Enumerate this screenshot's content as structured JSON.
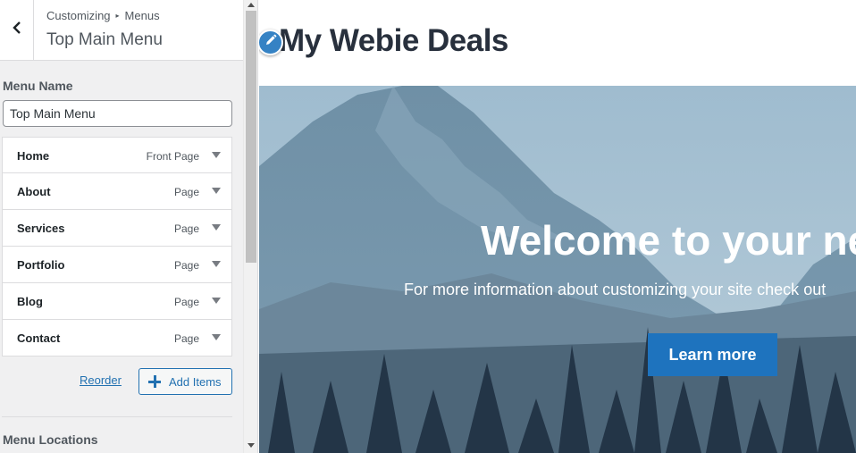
{
  "sidebar": {
    "breadcrumb": {
      "root": "Customizing",
      "separator": "▸",
      "section": "Menus"
    },
    "title": "Top Main Menu",
    "menu_name_label": "Menu Name",
    "menu_name_value": "Top Main Menu",
    "items": [
      {
        "title": "Home",
        "type": "Front Page"
      },
      {
        "title": "About",
        "type": "Page"
      },
      {
        "title": "Services",
        "type": "Page"
      },
      {
        "title": "Portfolio",
        "type": "Page"
      },
      {
        "title": "Blog",
        "type": "Page"
      },
      {
        "title": "Contact",
        "type": "Page"
      }
    ],
    "reorder_label": "Reorder",
    "add_items_label": "Add Items",
    "menu_locations_label": "Menu Locations"
  },
  "preview": {
    "site_title": "My Webie Deals",
    "hero": {
      "heading": "Welcome to your new",
      "subheading": "For more information about customizing your site check out",
      "button_label": "Learn more"
    }
  },
  "colors": {
    "accent": "#2271b1",
    "button": "#1e73be",
    "sidebar_bg": "#f0f0f1",
    "site_title": "#28303d"
  },
  "icons": {
    "back": "chevron-left-icon",
    "edit": "pencil-icon",
    "add": "plus-icon",
    "expand": "triangle-down-icon"
  }
}
